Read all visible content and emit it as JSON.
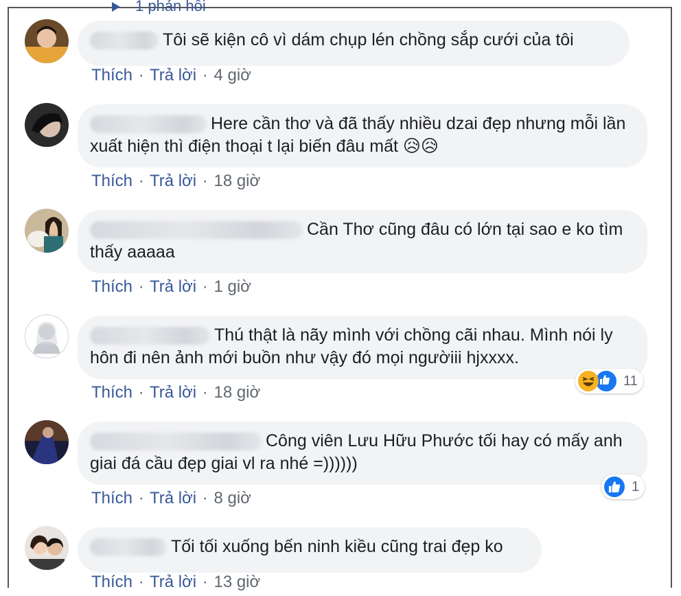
{
  "top_reply": {
    "label": "1 phản hồi"
  },
  "actions": {
    "like": "Thích",
    "reply": "Trả lời",
    "separator": "·"
  },
  "comments": [
    {
      "name_visible": "n",
      "text": "Tôi sẽ kiện cô vì dám chụp lén chồng sắp cưới của tôi",
      "time": "4 giờ"
    },
    {
      "name_visible": "n",
      "text": "Here cần thơ và đã thấy nhiều dzai đẹp nhưng mỗi lần xuất hiện thì điện thoại t lại biến đâu mất 😥😥",
      "time": "18 giờ"
    },
    {
      "name_visible": "",
      "text": "Cần Thơ cũng đâu có lớn tại sao e ko tìm thấy aaaaa",
      "time": "1 giờ"
    },
    {
      "name_visible": "g",
      "text": "Thú thật là nãy mình với chồng cãi nhau. Mình nói ly hôn đi nên ảnh mới buồn như vậy đó mọi ngườiii hjxxxx.",
      "time": "18 giờ",
      "reactions": {
        "icons": [
          "haha-icon",
          "like-icon"
        ],
        "count": "11"
      }
    },
    {
      "name_visible": "",
      "text": "Công viên Lưu Hữu Phước tối hay có mấy anh giai đá cầu đẹp giai vl ra nhé =))))))",
      "time": "8 giờ",
      "reactions": {
        "icons": [
          "like-icon"
        ],
        "count": "1"
      }
    },
    {
      "name_visible": "",
      "text": "Tối tối xuống bến ninh kiều cũng trai đẹp ko",
      "time": "13 giờ"
    }
  ],
  "colors": {
    "link": "#385898",
    "bubble": "#f2f3f5",
    "text": "#1c1e21",
    "meta": "#606770",
    "like_blue": "#1877f2",
    "haha_yellow": "#f7b125"
  }
}
